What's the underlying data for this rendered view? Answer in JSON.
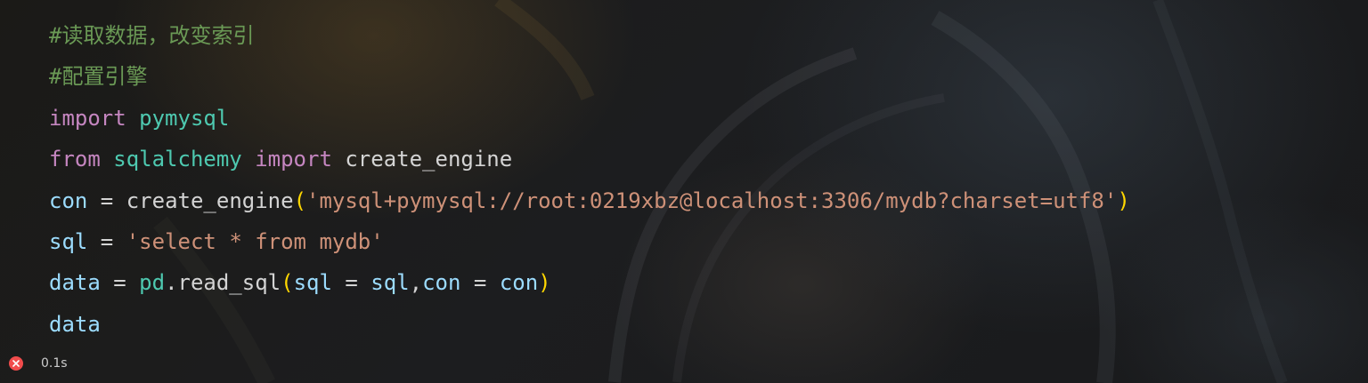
{
  "code_lines": [
    [
      {
        "t": "#读取数据，改变索引",
        "c": "cm"
      }
    ],
    [
      {
        "t": "#配置引擎",
        "c": "cm"
      }
    ],
    [
      {
        "t": "import",
        "c": "kw"
      },
      {
        "t": " ",
        "c": "op"
      },
      {
        "t": "pymysql",
        "c": "mod"
      }
    ],
    [
      {
        "t": "from",
        "c": "kw"
      },
      {
        "t": " ",
        "c": "op"
      },
      {
        "t": "sqlalchemy",
        "c": "mod"
      },
      {
        "t": " ",
        "c": "op"
      },
      {
        "t": "import",
        "c": "kw"
      },
      {
        "t": " create_engine",
        "c": "fn"
      }
    ],
    [
      {
        "t": "con",
        "c": "var"
      },
      {
        "t": " = ",
        "c": "op"
      },
      {
        "t": "create_engine",
        "c": "fn"
      },
      {
        "t": "(",
        "c": "par"
      },
      {
        "t": "'mysql+pymysql://root:0219xbz@localhost:3306/mydb?charset=utf8'",
        "c": "str"
      },
      {
        "t": ")",
        "c": "par"
      }
    ],
    [
      {
        "t": "sql",
        "c": "var"
      },
      {
        "t": " = ",
        "c": "op"
      },
      {
        "t": "'select * from mydb'",
        "c": "str"
      }
    ],
    [
      {
        "t": "data",
        "c": "var"
      },
      {
        "t": " = ",
        "c": "op"
      },
      {
        "t": "pd",
        "c": "mod"
      },
      {
        "t": ".read_sql",
        "c": "fn"
      },
      {
        "t": "(",
        "c": "par"
      },
      {
        "t": "sql",
        "c": "var"
      },
      {
        "t": " = ",
        "c": "op"
      },
      {
        "t": "sql",
        "c": "var"
      },
      {
        "t": ",",
        "c": "op"
      },
      {
        "t": "con",
        "c": "var"
      },
      {
        "t": " = ",
        "c": "op"
      },
      {
        "t": "con",
        "c": "var"
      },
      {
        "t": ")",
        "c": "par"
      }
    ],
    [
      {
        "t": "data",
        "c": "var"
      }
    ]
  ],
  "status": {
    "icon": "error-icon",
    "duration": "0.1s"
  },
  "colors": {
    "comment": "#6a9955",
    "keyword": "#c586c0",
    "module": "#4ec9b0",
    "variable": "#9cdcfe",
    "string": "#ce9178",
    "bracket": "#ffd700",
    "error": "#f14c4c"
  }
}
